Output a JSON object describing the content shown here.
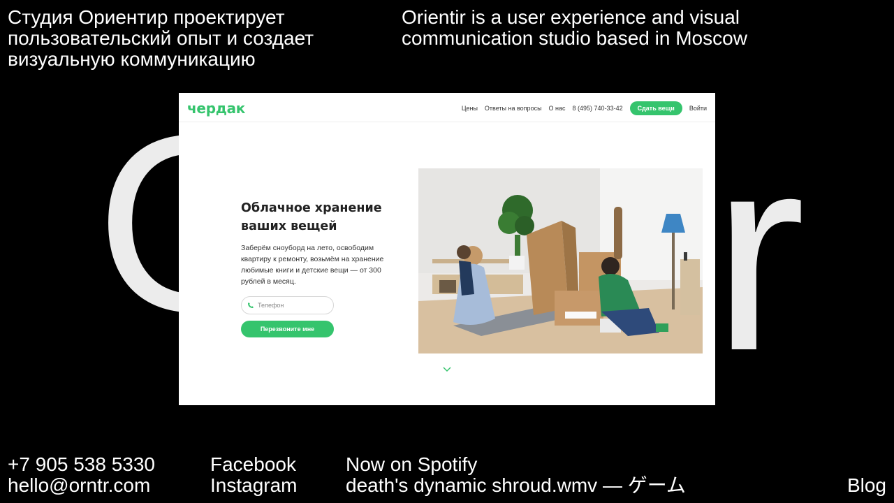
{
  "intro": {
    "ru": "Студия Ориентир проектирует пользовательский опыт и создает визуальную коммуникацию",
    "en": "Orientir is a user experience and visual communication studio based in Moscow"
  },
  "big_word": {
    "left_fragment": "O",
    "right_fragment": "r",
    "color": "#ececec"
  },
  "showcase": {
    "logo": "чердак",
    "nav": {
      "prices": "Цены",
      "faq": "Ответы на вопросы",
      "about": "О нас",
      "phone": "8 (495) 740-33-42",
      "cta": "Сдать вещи",
      "login": "Войти"
    },
    "hero": {
      "title": "Облачное хранение ваших вещей",
      "text": "Заберём сноуборд на лето, освободим квартиру к ремонту, возьмём на хранение любимые книги и детские вещи — от 300 рублей в месяц.",
      "phone_placeholder": "Телефон",
      "button": "Перезвоните мне"
    },
    "accent_color": "#35c46d",
    "scroll_icon": "chevron-down-icon"
  },
  "footer": {
    "phone": "+7 905 538 5330",
    "email": "hello@orntr.com",
    "facebook": "Facebook",
    "instagram": "Instagram",
    "now_label": "Now on Spotify",
    "track": "death's dynamic shroud.wmv — ゲーム",
    "blog": "Blog"
  }
}
